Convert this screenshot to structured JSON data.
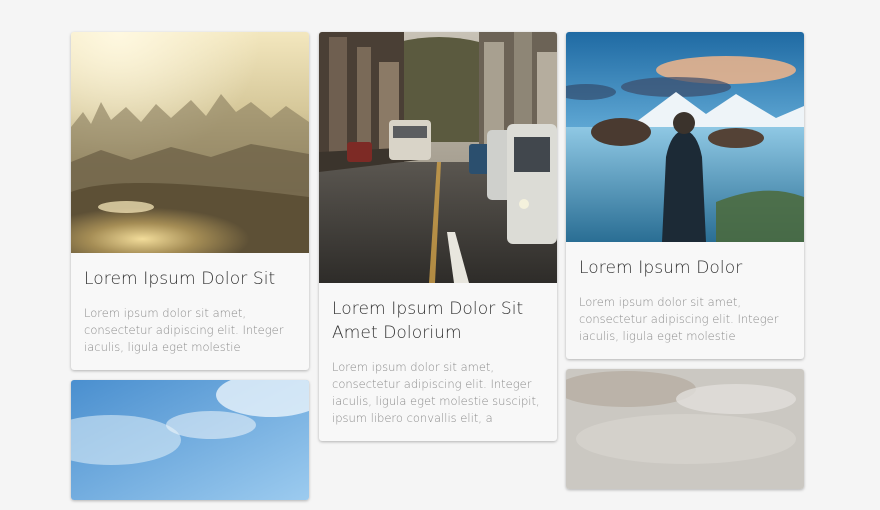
{
  "cards": [
    {
      "title": "Lorem Ipsum Dolor Sit",
      "text": "Lorem ipsum dolor sit amet, consectetur adipiscing elit. Integer iaculis, ligula eget molestie",
      "image": "hazy-city-sunrise-over-lake"
    },
    {
      "title": "",
      "text": "",
      "image": "cloudy-blue-sky"
    },
    {
      "title": "Lorem Ipsum Dolor Sit Amet Dolorium",
      "text": "Lorem ipsum dolor sit amet, consectetur adipiscing elit. Integer iaculis, ligula eget molestie suscipit, ipsum libero convallis elit, a",
      "image": "city-street-with-traffic"
    },
    {
      "title": "Lorem Ipsum Dolor",
      "text": "Lorem ipsum dolor sit amet, consectetur adipiscing elit. Integer iaculis, ligula eget molestie",
      "image": "person-facing-mountain-lake"
    },
    {
      "title": "",
      "text": "",
      "image": "pale-clouds-landscape"
    }
  ],
  "colors": {
    "page_background": "#f5f5f5",
    "card_background": "#f8f8f8",
    "title_color": "#333333",
    "text_color": "#8c8c8c"
  }
}
